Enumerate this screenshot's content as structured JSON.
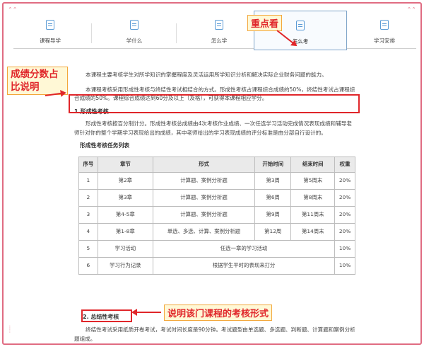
{
  "tabs": [
    {
      "label": "课程导学",
      "active": false
    },
    {
      "label": "学什么",
      "active": false
    },
    {
      "label": "怎么学",
      "active": false
    },
    {
      "label": "怎么考",
      "active": true
    },
    {
      "label": "学习安排",
      "active": false
    }
  ],
  "annotations": {
    "focus": "重点看",
    "score_ratio": "成绩分数占比说明",
    "exam_form": "说明该门课程的考核形式"
  },
  "content": {
    "intro": "本课程主要考核学生对所学知识的掌握程度及灵活运用所学知识分析和解决实际企业财务问题的能力。",
    "score_text": "本课程考核采用形成性考核与终结性考试相结合的方式。形成性考核占课程综合成绩的50%，终结性考试占课程综合成绩的50%。课程综合成绩达到60分及以上（及格），可获得本课程相应学分。",
    "section1_title": "1.形成性考核",
    "section1_text": "形成性考核按百分制计分。形成性考核总成绩由4次考核作业成绩、一次任选学习活动完成情况表现成绩和辅导老师针对你的整个学期学习表现给出的成绩，其中老师给出的学习表现成绩的评分标准是由分部自行设计的。",
    "table_title": "形成性考核任务列表",
    "table": {
      "headers": [
        "序号",
        "章节",
        "形式",
        "开始时间",
        "结束时间",
        "权重"
      ],
      "rows": [
        [
          "1",
          "第2章",
          "计算题、案例分析题",
          "第3周",
          "第5周末",
          "20%"
        ],
        [
          "2",
          "第3章",
          "计算题、案例分析题",
          "第6周",
          "第8周末",
          "20%"
        ],
        [
          "3",
          "第4-5章",
          "计算题、案例分析题",
          "第9周",
          "第11周末",
          "20%"
        ],
        [
          "4",
          "第1-8章",
          "单选、多选、计算、案例分析题",
          "第12周",
          "第14周末",
          "20%"
        ]
      ],
      "rows_merged": [
        [
          "5",
          "学习活动",
          "任选一章的学习活动",
          "10%"
        ],
        [
          "6",
          "学习行为记录",
          "根据学生平时的表现来打分",
          "10%"
        ]
      ]
    },
    "section2_title": "2. 总结性考核",
    "section2_text": "终结性考试采用纸质开卷考试，考试时间长度是90分钟。考试题型由单选题、多选题、判断题、计算题和案例分析题组成。"
  },
  "colors": {
    "accent": "#e0262a",
    "frame": "#e06c82",
    "tab_icon": "#5b9bd5"
  }
}
